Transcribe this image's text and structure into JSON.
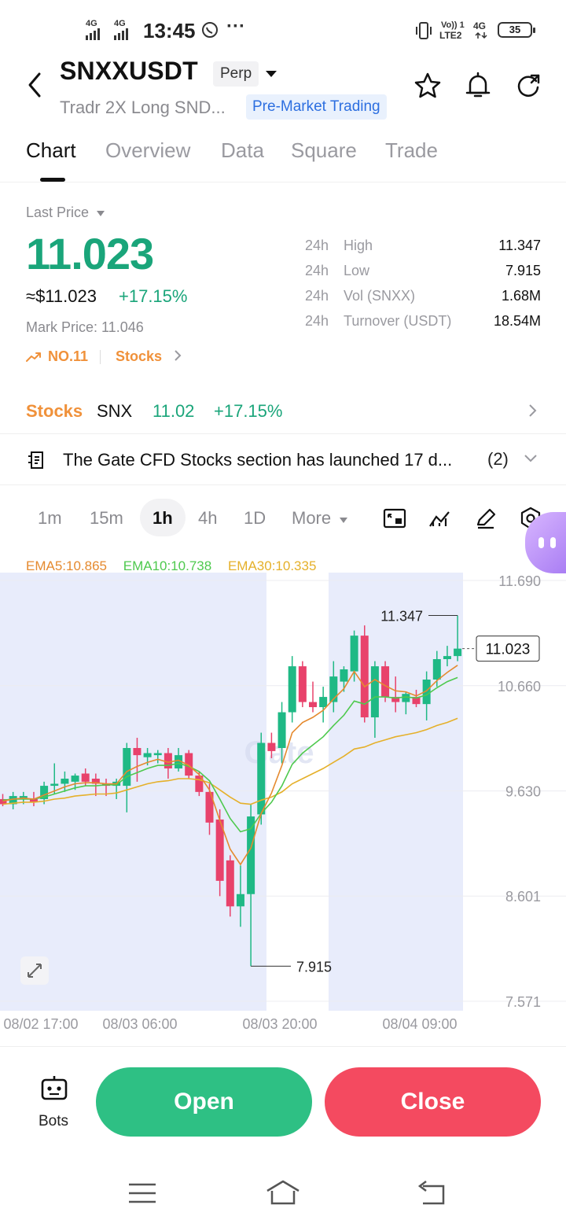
{
  "status_bar": {
    "time": "13:45",
    "net1": "4G",
    "net2": "4G",
    "net3": "Vo)) 1",
    "net3b": "LTE2",
    "net4": "4G",
    "battery": "35"
  },
  "header": {
    "symbol": "SNXXUSDT",
    "badge": "Perp",
    "subtitle": "Tradr 2X Long SND...",
    "tag": "Pre-Market Trading",
    "icons": [
      "back-icon",
      "caret-down-icon",
      "star-icon",
      "bell-icon",
      "refresh-icon"
    ]
  },
  "tabs": [
    "Chart",
    "Overview",
    "Data",
    "Square",
    "Trade"
  ],
  "active_tab": "Chart",
  "price": {
    "label": "Last Price",
    "value": "11.023",
    "usd": "≈$11.023",
    "change": "+17.15%",
    "mark": "Mark Price: 11.046",
    "rank": "NO.11",
    "category": "Stocks"
  },
  "stats": [
    {
      "period": "24h",
      "label": "High",
      "value": "11.347"
    },
    {
      "period": "24h",
      "label": "Low",
      "value": "7.915"
    },
    {
      "period": "24h",
      "label": "Vol (SNXX)",
      "value": "1.68M"
    },
    {
      "period": "24h",
      "label": "Turnover (USDT)",
      "value": "18.54M"
    }
  ],
  "stocks_row": {
    "category": "Stocks",
    "ticker": "SNX",
    "price": "11.02",
    "change": "+17.15%"
  },
  "announcement": {
    "text": "The Gate CFD Stocks section has launched 17 d...",
    "count": "(2)"
  },
  "intervals": [
    "1m",
    "15m",
    "1h",
    "4h",
    "1D",
    "More"
  ],
  "active_interval": "1h",
  "colors": {
    "up": "#1fb985",
    "down": "#e8426b",
    "ema5": "#e58a2f",
    "ema10": "#4ec94e",
    "ema30": "#e5b02a",
    "price_green": "#1aa57a",
    "accent_orange": "#f0913a"
  },
  "chart_data": {
    "type": "candlestick",
    "ema_labels": {
      "ema5": "EMA5:10.865",
      "ema10": "EMA10:10.738",
      "ema30": "EMA30:10.335"
    },
    "y_ticks": [
      "11.690",
      "10.660",
      "9.630",
      "8.601",
      "7.571"
    ],
    "ylim": [
      7.571,
      11.69
    ],
    "x_ticks": [
      "08/02 17:00",
      "08/03 06:00",
      "08/03 20:00",
      "08/04 09:00"
    ],
    "high_label": "11.347",
    "low_label": "7.915",
    "current_price": "11.023",
    "candles": [
      {
        "o": 9.55,
        "h": 9.6,
        "l": 9.48,
        "c": 9.5
      },
      {
        "o": 9.5,
        "h": 9.62,
        "l": 9.45,
        "c": 9.58
      },
      {
        "o": 9.55,
        "h": 9.62,
        "l": 9.5,
        "c": 9.58
      },
      {
        "o": 9.55,
        "h": 9.62,
        "l": 9.48,
        "c": 9.52
      },
      {
        "o": 9.55,
        "h": 9.72,
        "l": 9.5,
        "c": 9.68
      },
      {
        "o": 9.68,
        "h": 9.9,
        "l": 9.6,
        "c": 9.7
      },
      {
        "o": 9.7,
        "h": 9.82,
        "l": 9.62,
        "c": 9.75
      },
      {
        "o": 9.72,
        "h": 9.8,
        "l": 9.64,
        "c": 9.78
      },
      {
        "o": 9.8,
        "h": 9.85,
        "l": 9.68,
        "c": 9.72
      },
      {
        "o": 9.75,
        "h": 9.8,
        "l": 9.58,
        "c": 9.7
      },
      {
        "o": 9.7,
        "h": 9.75,
        "l": 9.58,
        "c": 9.68
      },
      {
        "o": 9.68,
        "h": 9.75,
        "l": 9.55,
        "c": 9.72
      },
      {
        "o": 9.68,
        "h": 10.1,
        "l": 9.42,
        "c": 10.05
      },
      {
        "o": 10.05,
        "h": 10.15,
        "l": 9.72,
        "c": 9.98
      },
      {
        "o": 9.96,
        "h": 10.05,
        "l": 9.88,
        "c": 10.0
      },
      {
        "o": 9.98,
        "h": 10.03,
        "l": 9.9,
        "c": 10.0
      },
      {
        "o": 10.0,
        "h": 10.05,
        "l": 9.75,
        "c": 9.85
      },
      {
        "o": 9.85,
        "h": 10.05,
        "l": 9.82,
        "c": 9.98
      },
      {
        "o": 10.0,
        "h": 10.03,
        "l": 9.75,
        "c": 9.78
      },
      {
        "o": 9.78,
        "h": 9.82,
        "l": 9.58,
        "c": 9.62
      },
      {
        "o": 9.62,
        "h": 9.7,
        "l": 9.2,
        "c": 9.32
      },
      {
        "o": 9.35,
        "h": 9.45,
        "l": 8.6,
        "c": 8.75
      },
      {
        "o": 8.95,
        "h": 9.0,
        "l": 8.4,
        "c": 8.5
      },
      {
        "o": 8.5,
        "h": 8.9,
        "l": 8.3,
        "c": 8.62
      },
      {
        "o": 8.62,
        "h": 9.5,
        "l": 7.915,
        "c": 9.38
      },
      {
        "o": 9.4,
        "h": 10.2,
        "l": 9.3,
        "c": 10.1
      },
      {
        "o": 10.1,
        "h": 10.2,
        "l": 9.95,
        "c": 10.02
      },
      {
        "o": 10.05,
        "h": 10.5,
        "l": 9.9,
        "c": 10.4
      },
      {
        "o": 10.4,
        "h": 10.95,
        "l": 10.3,
        "c": 10.85
      },
      {
        "o": 10.85,
        "h": 10.9,
        "l": 10.45,
        "c": 10.5
      },
      {
        "o": 10.5,
        "h": 10.7,
        "l": 10.4,
        "c": 10.45
      },
      {
        "o": 10.45,
        "h": 10.65,
        "l": 10.3,
        "c": 10.55
      },
      {
        "o": 10.5,
        "h": 10.9,
        "l": 10.4,
        "c": 10.75
      },
      {
        "o": 10.7,
        "h": 10.85,
        "l": 10.6,
        "c": 10.82
      },
      {
        "o": 10.8,
        "h": 11.2,
        "l": 10.7,
        "c": 11.15
      },
      {
        "o": 11.15,
        "h": 11.25,
        "l": 10.3,
        "c": 10.35
      },
      {
        "o": 10.35,
        "h": 10.9,
        "l": 10.15,
        "c": 10.85
      },
      {
        "o": 10.85,
        "h": 10.9,
        "l": 10.5,
        "c": 10.55
      },
      {
        "o": 10.55,
        "h": 10.75,
        "l": 10.4,
        "c": 10.5
      },
      {
        "o": 10.5,
        "h": 10.6,
        "l": 10.38,
        "c": 10.58
      },
      {
        "o": 10.55,
        "h": 10.62,
        "l": 10.45,
        "c": 10.48
      },
      {
        "o": 10.48,
        "h": 10.8,
        "l": 10.32,
        "c": 10.72
      },
      {
        "o": 10.72,
        "h": 11.0,
        "l": 10.65,
        "c": 10.92
      },
      {
        "o": 10.92,
        "h": 11.05,
        "l": 10.85,
        "c": 10.95
      },
      {
        "o": 10.95,
        "h": 11.347,
        "l": 10.9,
        "c": 11.023
      }
    ],
    "ema5": [
      9.53,
      9.55,
      9.56,
      9.55,
      9.59,
      9.63,
      9.67,
      9.7,
      9.71,
      9.71,
      9.7,
      9.7,
      9.82,
      9.87,
      9.91,
      9.94,
      9.91,
      9.93,
      9.88,
      9.79,
      9.64,
      9.34,
      9.06,
      8.91,
      9.07,
      9.41,
      9.61,
      9.88,
      10.2,
      10.3,
      10.35,
      10.42,
      10.53,
      10.63,
      10.8,
      10.65,
      10.72,
      10.66,
      10.61,
      10.6,
      10.56,
      10.61,
      10.71,
      10.79,
      10.86
    ],
    "ema10": [
      9.54,
      9.55,
      9.55,
      9.55,
      9.57,
      9.6,
      9.63,
      9.66,
      9.68,
      9.68,
      9.69,
      9.69,
      9.77,
      9.81,
      9.85,
      9.88,
      9.88,
      9.9,
      9.87,
      9.82,
      9.73,
      9.55,
      9.36,
      9.23,
      9.26,
      9.41,
      9.52,
      9.68,
      9.89,
      10.0,
      10.08,
      10.16,
      10.27,
      10.37,
      10.51,
      10.48,
      10.55,
      10.55,
      10.54,
      10.55,
      10.54,
      10.57,
      10.64,
      10.7,
      10.74
    ],
    "ema30": [
      9.5,
      9.51,
      9.52,
      9.52,
      9.53,
      9.55,
      9.56,
      9.58,
      9.59,
      9.6,
      9.6,
      9.61,
      9.64,
      9.67,
      9.7,
      9.72,
      9.73,
      9.75,
      9.75,
      9.74,
      9.71,
      9.64,
      9.57,
      9.51,
      9.5,
      9.54,
      9.57,
      9.62,
      9.7,
      9.75,
      9.8,
      9.85,
      9.91,
      9.97,
      10.04,
      10.06,
      10.1,
      10.13,
      10.16,
      10.18,
      10.2,
      10.23,
      10.27,
      10.3,
      10.34
    ]
  },
  "bottom": {
    "bots_label": "Bots",
    "open_label": "Open",
    "close_label": "Close"
  }
}
